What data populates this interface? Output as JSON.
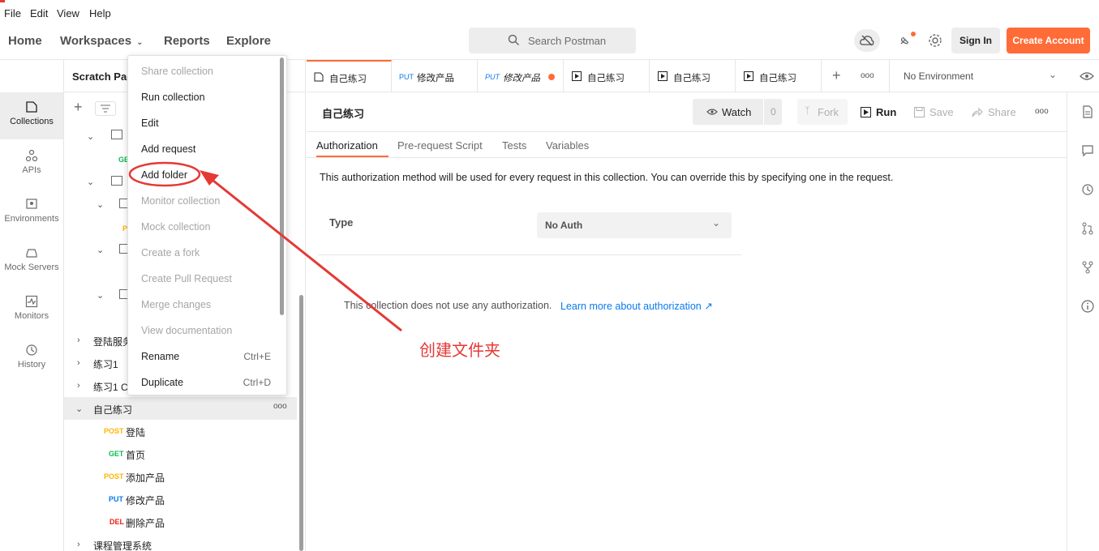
{
  "menubar": {
    "file": "File",
    "edit": "Edit",
    "view": "View",
    "help": "Help"
  },
  "topnav": {
    "home": "Home",
    "workspaces": "Workspaces",
    "reports": "Reports",
    "explore": "Explore",
    "search_placeholder": "Search Postman",
    "sign_in": "Sign In",
    "create_account": "Create Account",
    "accent_color": "#ff6c37"
  },
  "rail": {
    "items": [
      {
        "label": "Collections",
        "icon": "collections-icon"
      },
      {
        "label": "APIs",
        "icon": "apis-icon"
      },
      {
        "label": "Environments",
        "icon": "environments-icon"
      },
      {
        "label": "Mock Servers",
        "icon": "mock-servers-icon"
      },
      {
        "label": "Monitors",
        "icon": "monitors-icon"
      },
      {
        "label": "History",
        "icon": "history-icon"
      }
    ]
  },
  "panel": {
    "title": "Scratch Pad",
    "header_button_fragment": "t",
    "partial_method": "GE",
    "partial_method2": "P",
    "tree": [
      {
        "label": "登陆服务",
        "expanded": false
      },
      {
        "label": "练习1",
        "expanded": false
      },
      {
        "label": "练习1 C",
        "expanded": false
      },
      {
        "label": "自己练习",
        "expanded": true,
        "more": "ooo"
      },
      {
        "method": "POST",
        "label": "登陆",
        "method_color": "#ffb400"
      },
      {
        "method": "GET",
        "label": "首页",
        "method_color": "#0cbb52"
      },
      {
        "method": "POST",
        "label": "添加产品",
        "method_color": "#ffb400"
      },
      {
        "method": "PUT",
        "label": "修改产品",
        "method_color": "#097bed"
      },
      {
        "method": "DEL",
        "label": "删除产品",
        "method_color": "#eb2013"
      },
      {
        "label": "课程管理系统",
        "expanded": false
      }
    ]
  },
  "context_menu": {
    "items": [
      {
        "label": "Share collection",
        "disabled": true,
        "shortcut": ""
      },
      {
        "label": "Run collection",
        "disabled": false,
        "shortcut": ""
      },
      {
        "label": "Edit",
        "disabled": false,
        "shortcut": ""
      },
      {
        "label": "Add request",
        "disabled": false,
        "shortcut": ""
      },
      {
        "label": "Add folder",
        "disabled": false,
        "shortcut": ""
      },
      {
        "label": "Monitor collection",
        "disabled": true,
        "shortcut": ""
      },
      {
        "label": "Mock collection",
        "disabled": true,
        "shortcut": ""
      },
      {
        "label": "Create a fork",
        "disabled": true,
        "shortcut": ""
      },
      {
        "label": "Create Pull Request",
        "disabled": true,
        "shortcut": ""
      },
      {
        "label": "Merge changes",
        "disabled": true,
        "shortcut": ""
      },
      {
        "label": "View documentation",
        "disabled": true,
        "shortcut": ""
      },
      {
        "label": "Rename",
        "disabled": false,
        "shortcut": "Ctrl+E"
      },
      {
        "label": "Duplicate",
        "disabled": false,
        "shortcut": "Ctrl+D"
      }
    ]
  },
  "tabs": {
    "items": [
      {
        "method": "",
        "label": "自己练习",
        "type": "collection"
      },
      {
        "method": "PUT",
        "label": "修改产品",
        "unsaved": true
      },
      {
        "method": "PUT",
        "label": "修改产品",
        "italic": true
      },
      {
        "method": "",
        "label": "自己练习",
        "type": "runner"
      },
      {
        "method": "",
        "label": "自己练习",
        "type": "runner"
      },
      {
        "method": "",
        "label": "自己练习",
        "type": "runner"
      }
    ],
    "more": "ooo",
    "environment": "No Environment"
  },
  "collection": {
    "title": "自己练习",
    "watch": "Watch",
    "watch_count": "0",
    "fork": "Fork",
    "run": "Run",
    "save": "Save",
    "share": "Share",
    "more": "ooo",
    "subtabs": [
      "Authorization",
      "Pre-request Script",
      "Tests",
      "Variables"
    ],
    "auth_description": "This authorization method will be used for every request in this collection. You can override this by specifying one in the request.",
    "type_label": "Type",
    "type_value": "No Auth",
    "no_auth_text": "This collection does not use any authorization.",
    "learn_more": "Learn more about authorization ↗"
  },
  "annotation": {
    "text": "创建文件夹",
    "color": "#e53935"
  }
}
